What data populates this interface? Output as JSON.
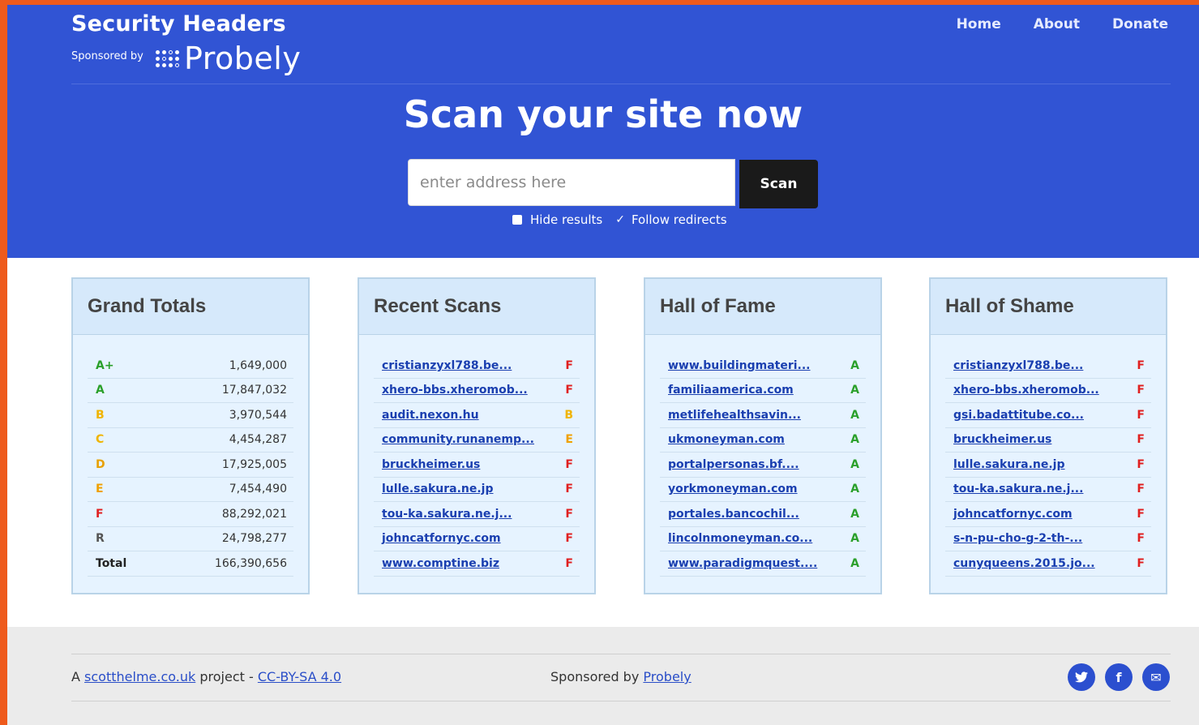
{
  "header": {
    "brand_title": "Security Headers",
    "sponsored_by": "Sponsored by",
    "sponsor_logo_text": "Probely",
    "nav": [
      "Home",
      "About",
      "Donate"
    ]
  },
  "hero": {
    "title": "Scan your site now",
    "input_placeholder": "enter address here",
    "scan_button": "Scan",
    "hide_results_label": "Hide results",
    "hide_results_checked": false,
    "follow_redirects_label": "Follow redirects",
    "follow_redirects_checked": true
  },
  "colors": {
    "header_bg": "#3154d4",
    "frame": "#ee5a1c",
    "grade_A": "#2ba02b",
    "grade_Aplus": "#2ba02b",
    "grade_B": "#f0b400",
    "grade_C": "#f0b400",
    "grade_D": "#e8a000",
    "grade_E": "#f0a000",
    "grade_F": "#e02020",
    "grade_R": "#555555"
  },
  "cards": {
    "grand_totals": {
      "title": "Grand Totals",
      "rows": [
        {
          "grade": "A+",
          "value": "1,649,000"
        },
        {
          "grade": "A",
          "value": "17,847,032"
        },
        {
          "grade": "B",
          "value": "3,970,544"
        },
        {
          "grade": "C",
          "value": "4,454,287"
        },
        {
          "grade": "D",
          "value": "17,925,005"
        },
        {
          "grade": "E",
          "value": "7,454,490"
        },
        {
          "grade": "F",
          "value": "88,292,021"
        },
        {
          "grade": "R",
          "value": "24,798,277"
        },
        {
          "grade": "Total",
          "value": "166,390,656"
        }
      ]
    },
    "recent_scans": {
      "title": "Recent Scans",
      "rows": [
        {
          "site": "cristianzyxl788.be...",
          "grade": "F"
        },
        {
          "site": "xhero-bbs.xheromob...",
          "grade": "F"
        },
        {
          "site": "audit.nexon.hu",
          "grade": "B"
        },
        {
          "site": "community.runanemp...",
          "grade": "E"
        },
        {
          "site": "bruckheimer.us",
          "grade": "F"
        },
        {
          "site": "lulle.sakura.ne.jp",
          "grade": "F"
        },
        {
          "site": "tou-ka.sakura.ne.j...",
          "grade": "F"
        },
        {
          "site": "johncatfornyc.com",
          "grade": "F"
        },
        {
          "site": "www.comptine.biz",
          "grade": "F"
        }
      ]
    },
    "hall_of_fame": {
      "title": "Hall of Fame",
      "rows": [
        {
          "site": "www.buildingmateri...",
          "grade": "A"
        },
        {
          "site": "familiaamerica.com",
          "grade": "A"
        },
        {
          "site": "metlifehealthsavin...",
          "grade": "A"
        },
        {
          "site": "ukmoneyman.com",
          "grade": "A"
        },
        {
          "site": "portalpersonas.bf....",
          "grade": "A"
        },
        {
          "site": "yorkmoneyman.com",
          "grade": "A"
        },
        {
          "site": "portales.bancochil...",
          "grade": "A"
        },
        {
          "site": "lincolnmoneyman.co...",
          "grade": "A"
        },
        {
          "site": "www.paradigmquest....",
          "grade": "A"
        }
      ]
    },
    "hall_of_shame": {
      "title": "Hall of Shame",
      "rows": [
        {
          "site": "cristianzyxl788.be...",
          "grade": "F"
        },
        {
          "site": "xhero-bbs.xheromob...",
          "grade": "F"
        },
        {
          "site": "gsi.badattitube.co...",
          "grade": "F"
        },
        {
          "site": "bruckheimer.us",
          "grade": "F"
        },
        {
          "site": "lulle.sakura.ne.jp",
          "grade": "F"
        },
        {
          "site": "tou-ka.sakura.ne.j...",
          "grade": "F"
        },
        {
          "site": "johncatfornyc.com",
          "grade": "F"
        },
        {
          "site": "s-n-pu-cho-g-2-th-...",
          "grade": "F"
        },
        {
          "site": "cunyqueens.2015.jo...",
          "grade": "F"
        }
      ]
    }
  },
  "footer": {
    "prefix": "A",
    "site_link": "scotthelme.co.uk",
    "project_text": "project -",
    "license_link": "CC-BY-SA 4.0",
    "sponsored_text": "Sponsored by",
    "sponsor_link": "Probely",
    "social": [
      {
        "icon": "twitter-icon",
        "glyph": "🐦"
      },
      {
        "icon": "facebook-icon",
        "glyph": "f"
      },
      {
        "icon": "email-icon",
        "glyph": "✉"
      }
    ]
  }
}
